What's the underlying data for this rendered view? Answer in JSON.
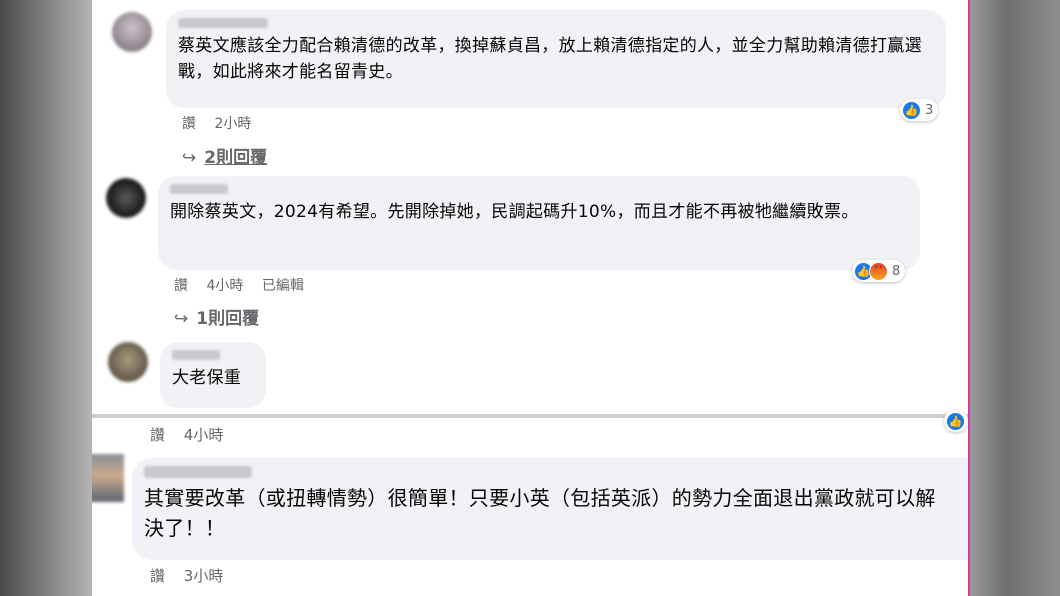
{
  "comments": [
    {
      "text": "蔡英文應該全力配合賴清德的改革，換掉蘇貞昌，放上賴清德指定的人，並全力幫助賴清德打贏選戰，如此將來才能名留青史。",
      "like_label": "讚",
      "time": "2小時",
      "reaction_count": "3",
      "replies_label": "2則回覆"
    },
    {
      "text": "開除蔡英文，2024有希望。先開除掉她，民調起碼升10%，而且才能不再被牠繼續敗票。",
      "like_label": "讚",
      "time": "4小時",
      "edited": "已編輯",
      "reaction_count": "8",
      "replies_label": "1則回覆"
    },
    {
      "text": "大老保重",
      "like_label": "讚",
      "time": "4小時"
    },
    {
      "text": "其實要改革（或扭轉情勢）很簡單！只要小英（包括英派）的勢力全面退出黨政就可以解決了！！",
      "like_label": "讚",
      "time": "3小時"
    }
  ],
  "icons": {
    "reply_arrow": "reply-arrow-icon",
    "like": "like-icon",
    "angry": "angry-icon"
  },
  "colors": {
    "bubble": "#f0f2f5",
    "meta_text": "#65676b",
    "like_blue": "#1877f2",
    "edge_magenta": "#d63aa7"
  }
}
